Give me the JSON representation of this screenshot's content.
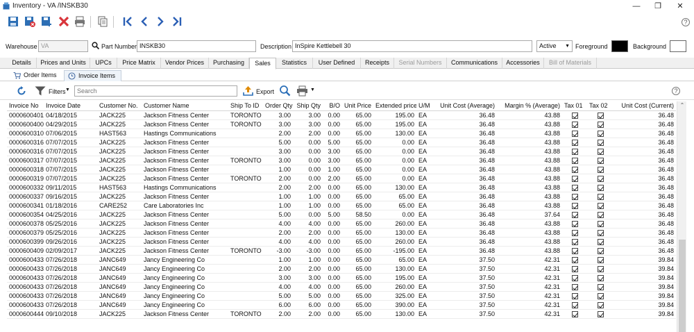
{
  "window": {
    "title": "Inventory - VA   /INSKB30",
    "minimize": "—",
    "restore": "❐",
    "close": "✕"
  },
  "header": {
    "warehouse_label": "Warehouse",
    "warehouse_value": "VA",
    "part_number_label": "Part Number",
    "part_number_value": "INSKB30",
    "description_label": "Description",
    "description_value": "InSpire Kettlebell 30",
    "status_value": "Active",
    "foreground_label": "Foreground",
    "background_label": "Background",
    "foreground_color": "#000000",
    "background_color": "#ffffff"
  },
  "tabs": [
    {
      "label": "Details"
    },
    {
      "label": "Prices and Units"
    },
    {
      "label": "UPCs"
    },
    {
      "label": "Price Matrix"
    },
    {
      "label": "Vendor Prices"
    },
    {
      "label": "Purchasing"
    },
    {
      "label": "Sales"
    },
    {
      "label": "Statistics"
    },
    {
      "label": "User Defined"
    },
    {
      "label": "Receipts"
    },
    {
      "label": "Serial Numbers"
    },
    {
      "label": "Communications"
    },
    {
      "label": "Accessories"
    },
    {
      "label": "Bill of Materials"
    }
  ],
  "subtabs": [
    {
      "label": "Order Items"
    },
    {
      "label": "Invoice Items"
    }
  ],
  "gridbar": {
    "filters_label": "Filters",
    "search_placeholder": "Search",
    "export_label": "Export"
  },
  "columns": [
    "Invoice No",
    "Invoice Date",
    "Customer No.",
    "Customer Name",
    "Ship To ID",
    "Order Qty",
    "Ship Qty",
    "B/O",
    "Unit Price",
    "Extended price",
    "U/M",
    "Unit Cost (Average)",
    "Margin % (Average)",
    "Tax 01",
    "Tax 02",
    "Unit Cost (Current)"
  ],
  "rows": [
    [
      "0000600401",
      "04/18/2015",
      "JACK225",
      "Jackson Fitness Center",
      "TORONTO",
      "3.00",
      "3.00",
      "0.00",
      "65.00",
      "195.00",
      "EA",
      "36.48",
      "43.88",
      "true",
      "true",
      "36.48"
    ],
    [
      "0000600400",
      "04/29/2015",
      "JACK225",
      "Jackson Fitness Center",
      "TORONTO",
      "3.00",
      "3.00",
      "0.00",
      "65.00",
      "195.00",
      "EA",
      "36.48",
      "43.88",
      "true",
      "true",
      "36.48"
    ],
    [
      "0000600310",
      "07/06/2015",
      "HAST563",
      "Hastings Communications",
      "",
      "2.00",
      "2.00",
      "0.00",
      "65.00",
      "130.00",
      "EA",
      "36.48",
      "43.88",
      "true",
      "true",
      "36.48"
    ],
    [
      "0000600316",
      "07/07/2015",
      "JACK225",
      "Jackson Fitness Center",
      "",
      "5.00",
      "0.00",
      "5.00",
      "65.00",
      "0.00",
      "EA",
      "36.48",
      "43.88",
      "true",
      "true",
      "36.48"
    ],
    [
      "0000600316",
      "07/07/2015",
      "JACK225",
      "Jackson Fitness Center",
      "",
      "3.00",
      "0.00",
      "3.00",
      "65.00",
      "0.00",
      "EA",
      "36.48",
      "43.88",
      "true",
      "true",
      "36.48"
    ],
    [
      "0000600317",
      "07/07/2015",
      "JACK225",
      "Jackson Fitness Center",
      "TORONTO",
      "3.00",
      "0.00",
      "3.00",
      "65.00",
      "0.00",
      "EA",
      "36.48",
      "43.88",
      "true",
      "true",
      "36.48"
    ],
    [
      "0000600318",
      "07/07/2015",
      "JACK225",
      "Jackson Fitness Center",
      "",
      "1.00",
      "0.00",
      "1.00",
      "65.00",
      "0.00",
      "EA",
      "36.48",
      "43.88",
      "true",
      "true",
      "36.48"
    ],
    [
      "0000600319",
      "07/07/2015",
      "JACK225",
      "Jackson Fitness Center",
      "TORONTO",
      "2.00",
      "0.00",
      "2.00",
      "65.00",
      "0.00",
      "EA",
      "36.48",
      "43.88",
      "true",
      "true",
      "36.48"
    ],
    [
      "0000600332",
      "09/11/2015",
      "HAST563",
      "Hastings Communications",
      "",
      "2.00",
      "2.00",
      "0.00",
      "65.00",
      "130.00",
      "EA",
      "36.48",
      "43.88",
      "true",
      "true",
      "36.48"
    ],
    [
      "0000600337",
      "09/16/2015",
      "JACK225",
      "Jackson Fitness Center",
      "",
      "1.00",
      "1.00",
      "0.00",
      "65.00",
      "65.00",
      "EA",
      "36.48",
      "43.88",
      "true",
      "true",
      "36.48"
    ],
    [
      "0000600341",
      "01/18/2016",
      "CARE252",
      "Care Laboratories Inc",
      "",
      "1.00",
      "1.00",
      "0.00",
      "65.00",
      "65.00",
      "EA",
      "36.48",
      "43.88",
      "true",
      "true",
      "36.48"
    ],
    [
      "0000600354",
      "04/25/2016",
      "JACK225",
      "Jackson Fitness Center",
      "",
      "5.00",
      "0.00",
      "5.00",
      "58.50",
      "0.00",
      "EA",
      "36.48",
      "37.64",
      "true",
      "true",
      "36.48"
    ],
    [
      "0000600378",
      "05/25/2016",
      "JACK225",
      "Jackson Fitness Center",
      "",
      "4.00",
      "4.00",
      "0.00",
      "65.00",
      "260.00",
      "EA",
      "36.48",
      "43.88",
      "true",
      "true",
      "36.48"
    ],
    [
      "0000600379",
      "05/25/2016",
      "JACK225",
      "Jackson Fitness Center",
      "",
      "2.00",
      "2.00",
      "0.00",
      "65.00",
      "130.00",
      "EA",
      "36.48",
      "43.88",
      "true",
      "true",
      "36.48"
    ],
    [
      "0000600399",
      "09/26/2016",
      "JACK225",
      "Jackson Fitness Center",
      "",
      "4.00",
      "4.00",
      "0.00",
      "65.00",
      "260.00",
      "EA",
      "36.48",
      "43.88",
      "true",
      "true",
      "36.48"
    ],
    [
      "0000600409",
      "02/09/2017",
      "JACK225",
      "Jackson Fitness Center",
      "TORONTO",
      "-3.00",
      "-3.00",
      "0.00",
      "65.00",
      "-195.00",
      "EA",
      "36.48",
      "43.88",
      "true",
      "true",
      "36.48"
    ],
    [
      "0000600433",
      "07/26/2018",
      "JANC649",
      "Jancy Engineering Co",
      "",
      "1.00",
      "1.00",
      "0.00",
      "65.00",
      "65.00",
      "EA",
      "37.50",
      "42.31",
      "true",
      "true",
      "39.84"
    ],
    [
      "0000600433",
      "07/26/2018",
      "JANC649",
      "Jancy Engineering Co",
      "",
      "2.00",
      "2.00",
      "0.00",
      "65.00",
      "130.00",
      "EA",
      "37.50",
      "42.31",
      "true",
      "true",
      "39.84"
    ],
    [
      "0000600433",
      "07/26/2018",
      "JANC649",
      "Jancy Engineering Co",
      "",
      "3.00",
      "3.00",
      "0.00",
      "65.00",
      "195.00",
      "EA",
      "37.50",
      "42.31",
      "true",
      "true",
      "39.84"
    ],
    [
      "0000600433",
      "07/26/2018",
      "JANC649",
      "Jancy Engineering Co",
      "",
      "4.00",
      "4.00",
      "0.00",
      "65.00",
      "260.00",
      "EA",
      "37.50",
      "42.31",
      "true",
      "true",
      "39.84"
    ],
    [
      "0000600433",
      "07/26/2018",
      "JANC649",
      "Jancy Engineering Co",
      "",
      "5.00",
      "5.00",
      "0.00",
      "65.00",
      "325.00",
      "EA",
      "37.50",
      "42.31",
      "true",
      "true",
      "39.84"
    ],
    [
      "0000600433",
      "07/26/2018",
      "JANC649",
      "Jancy Engineering Co",
      "",
      "6.00",
      "6.00",
      "0.00",
      "65.00",
      "390.00",
      "EA",
      "37.50",
      "42.31",
      "true",
      "true",
      "39.84"
    ],
    [
      "0000600444",
      "09/10/2018",
      "JACK225",
      "Jackson Fitness Center",
      "TORONTO",
      "2.00",
      "2.00",
      "0.00",
      "65.00",
      "130.00",
      "EA",
      "37.50",
      "42.31",
      "true",
      "true",
      "39.84"
    ]
  ],
  "colors": {
    "accent": "#1f6fb2",
    "delete": "#d9353b",
    "nav": "#2b5fb5"
  }
}
